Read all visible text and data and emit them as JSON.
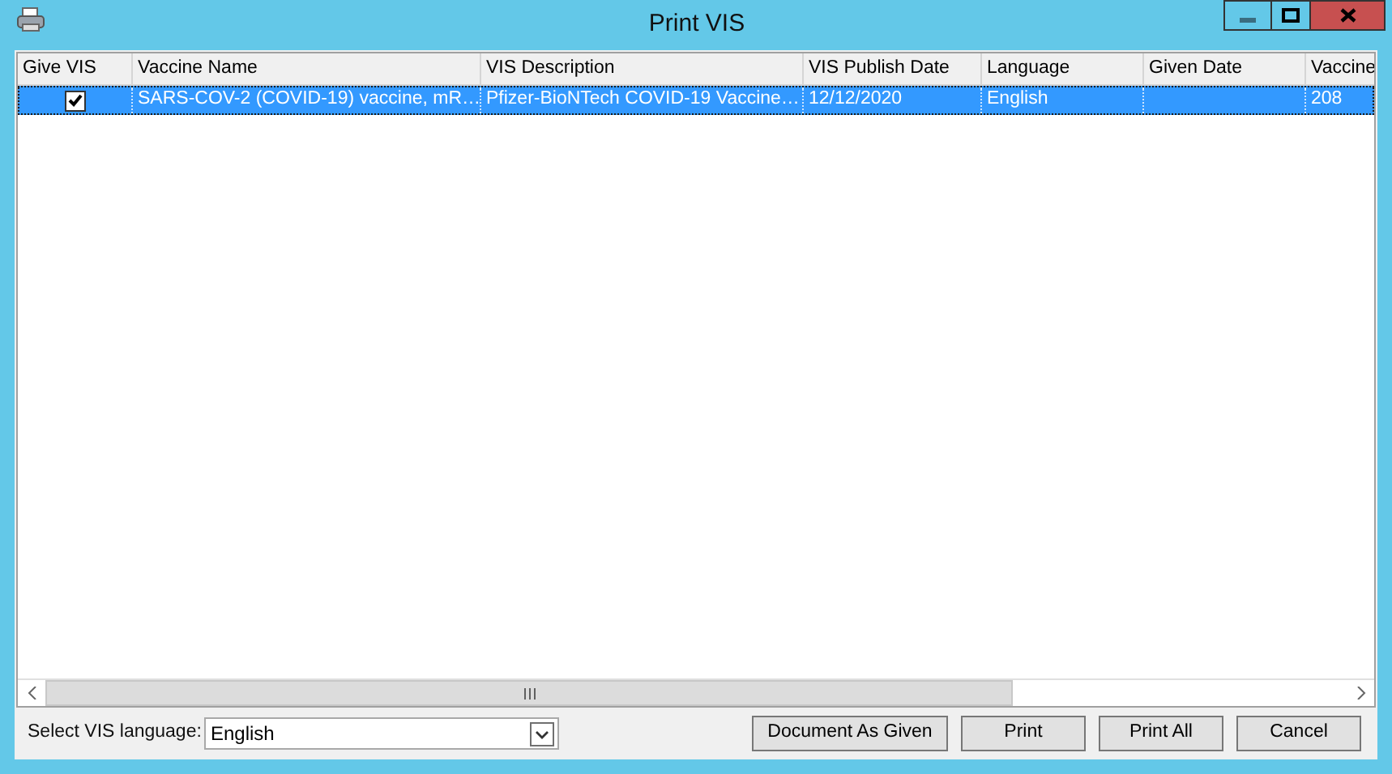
{
  "window": {
    "title": "Print VIS"
  },
  "table": {
    "columns": [
      "Give VIS",
      "Vaccine Name",
      "VIS Description",
      "VIS Publish Date",
      "Language",
      "Given Date",
      "Vaccine"
    ],
    "rows": [
      {
        "selected": true,
        "give_vis_checked": true,
        "cells": [
          "",
          "SARS-COV-2 (COVID-19) vaccine, mR…",
          "Pfizer-BioNTech COVID-19 Vaccine…",
          "12/12/2020",
          "English",
          "",
          "208"
        ]
      }
    ]
  },
  "language_select": {
    "label": "Select VIS language:",
    "value": "English"
  },
  "buttons": [
    "Document As Given",
    "Print",
    "Print All",
    "Cancel"
  ]
}
